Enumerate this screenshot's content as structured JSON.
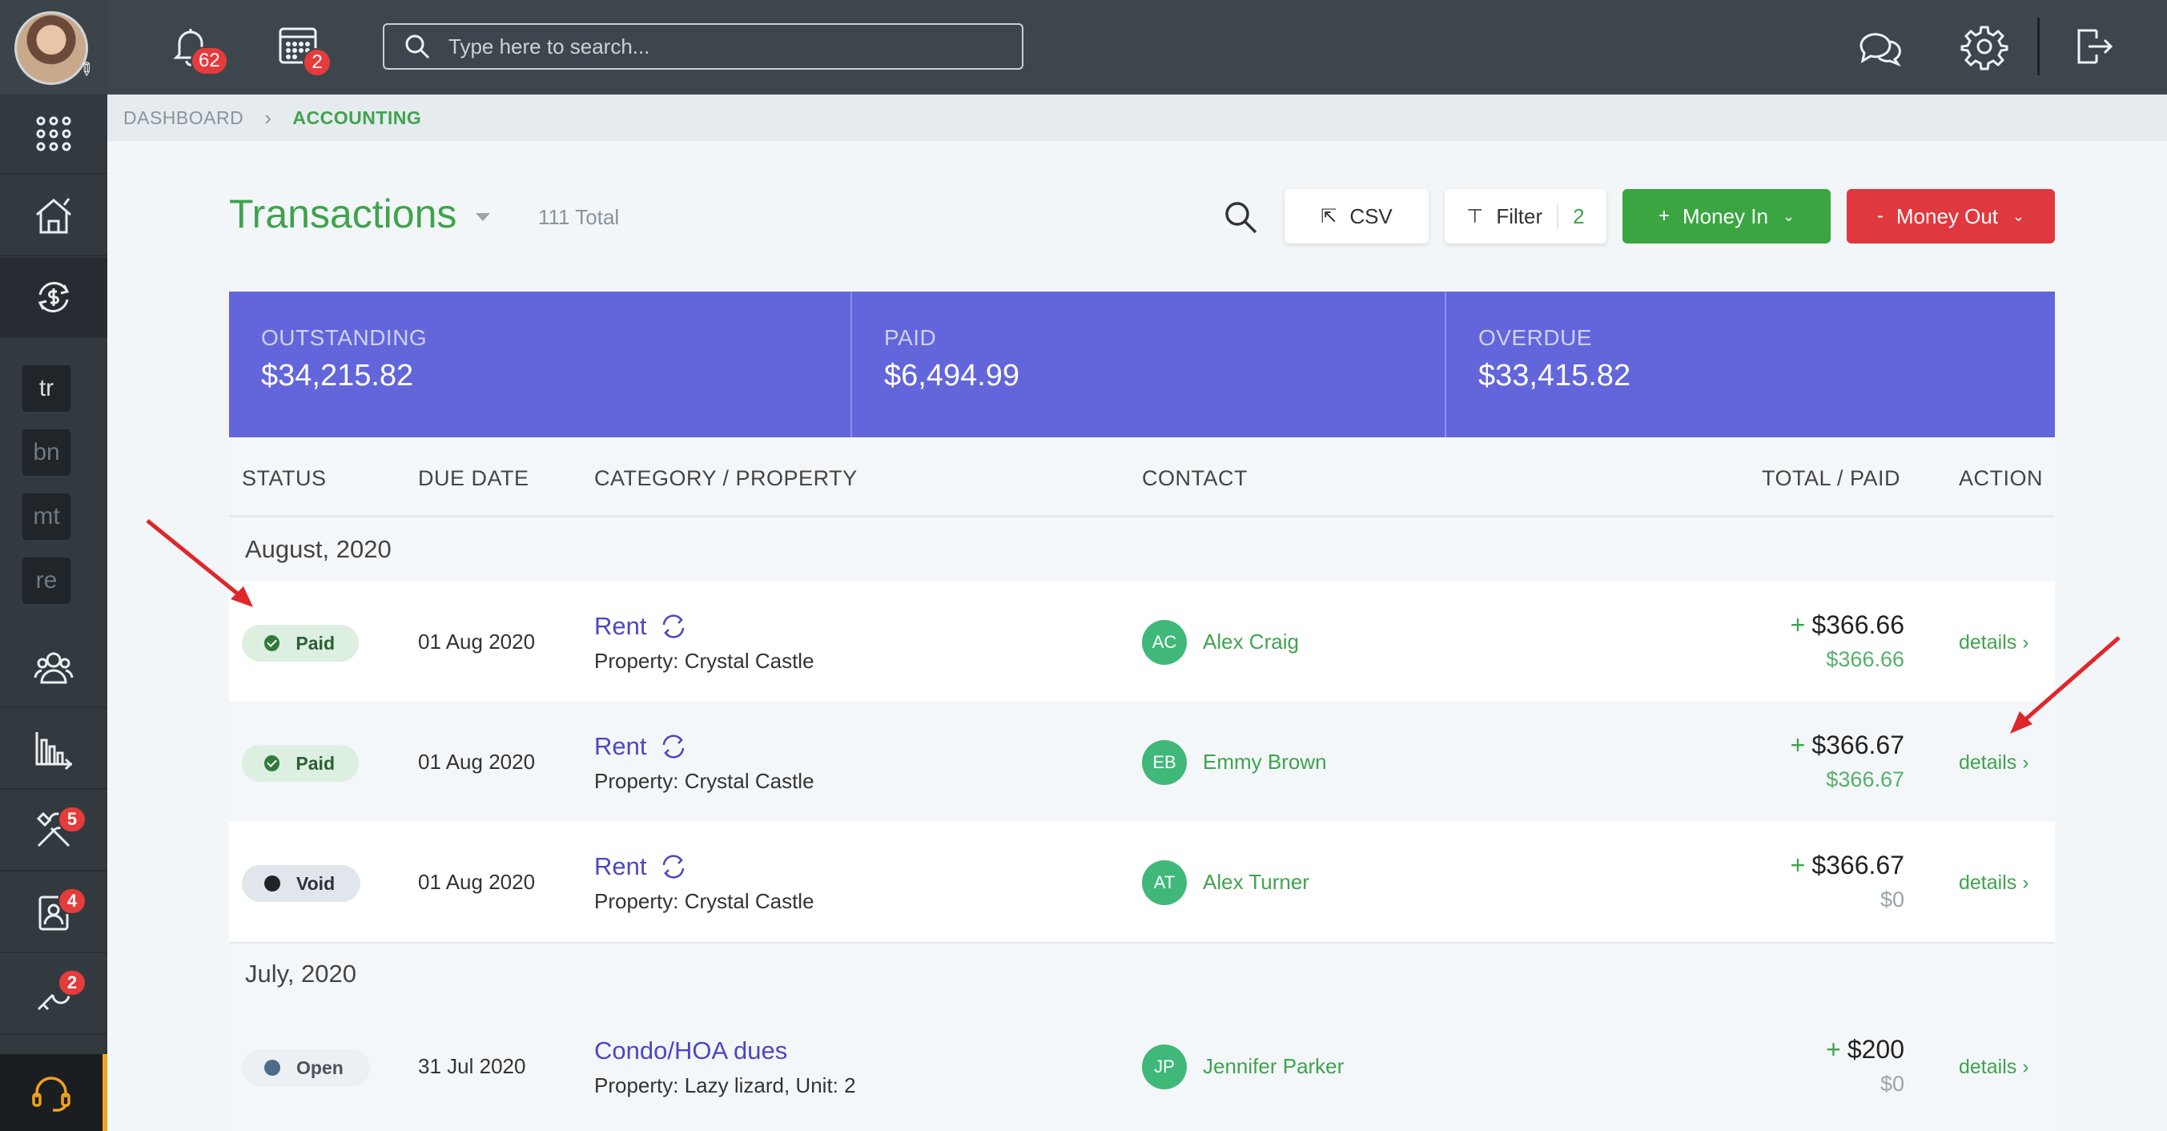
{
  "topbar": {
    "notifications_count": "62",
    "calendar_count": "2",
    "search_placeholder": "Type here to search..."
  },
  "sidebar": {
    "quick_links": [
      "tr",
      "bn",
      "mt",
      "re"
    ],
    "badges": {
      "maintenance": "5",
      "tenants": "4",
      "tools": "2"
    }
  },
  "breadcrumb": {
    "item1": "DASHBOARD",
    "item2": "ACCOUNTING"
  },
  "header": {
    "title": "Transactions",
    "total": "111 Total",
    "csv_label": "CSV",
    "filter_label": "Filter",
    "filter_count": "2",
    "money_in_label": "Money In",
    "money_out_label": "Money Out"
  },
  "summary": {
    "outstanding_label": "OUTSTANDING",
    "outstanding_value": "$34,215.82",
    "paid_label": "PAID",
    "paid_value": "$6,494.99",
    "overdue_label": "OVERDUE",
    "overdue_value": "$33,415.82"
  },
  "table": {
    "headers": {
      "status": "STATUS",
      "due_date": "DUE DATE",
      "category": "CATEGORY / PROPERTY",
      "contact": "CONTACT",
      "total": "TOTAL / PAID",
      "action": "ACTION"
    },
    "groups": [
      {
        "label": "August, 2020",
        "rows": [
          {
            "status": "Paid",
            "due": "01 Aug 2020",
            "category": "Rent",
            "property": "Property: Crystal Castle",
            "initials": "AC",
            "contact": "Alex Craig",
            "total": "$366.66",
            "paid": "$366.66",
            "action": "details"
          },
          {
            "status": "Paid",
            "due": "01 Aug 2020",
            "category": "Rent",
            "property": "Property: Crystal Castle",
            "initials": "EB",
            "contact": "Emmy Brown",
            "total": "$366.67",
            "paid": "$366.67",
            "action": "details"
          },
          {
            "status": "Void",
            "due": "01 Aug 2020",
            "category": "Rent",
            "property": "Property: Crystal Castle",
            "initials": "AT",
            "contact": "Alex Turner",
            "total": "$366.67",
            "paid": "$0",
            "action": "details"
          }
        ]
      },
      {
        "label": "July, 2020",
        "rows": [
          {
            "status": "Open",
            "due": "31 Jul 2020",
            "category": "Condo/HOA dues",
            "property": "Property: Lazy lizard, Unit: 2",
            "initials": "JP",
            "contact": "Jennifer Parker",
            "total": "$200",
            "paid": "$0",
            "action": "details"
          }
        ]
      }
    ]
  },
  "colors": {
    "accent_green": "#3fa34d",
    "summary_purple": "#6366da",
    "money_out_red": "#e0383f",
    "annotation_arrow": "#e0262b"
  }
}
